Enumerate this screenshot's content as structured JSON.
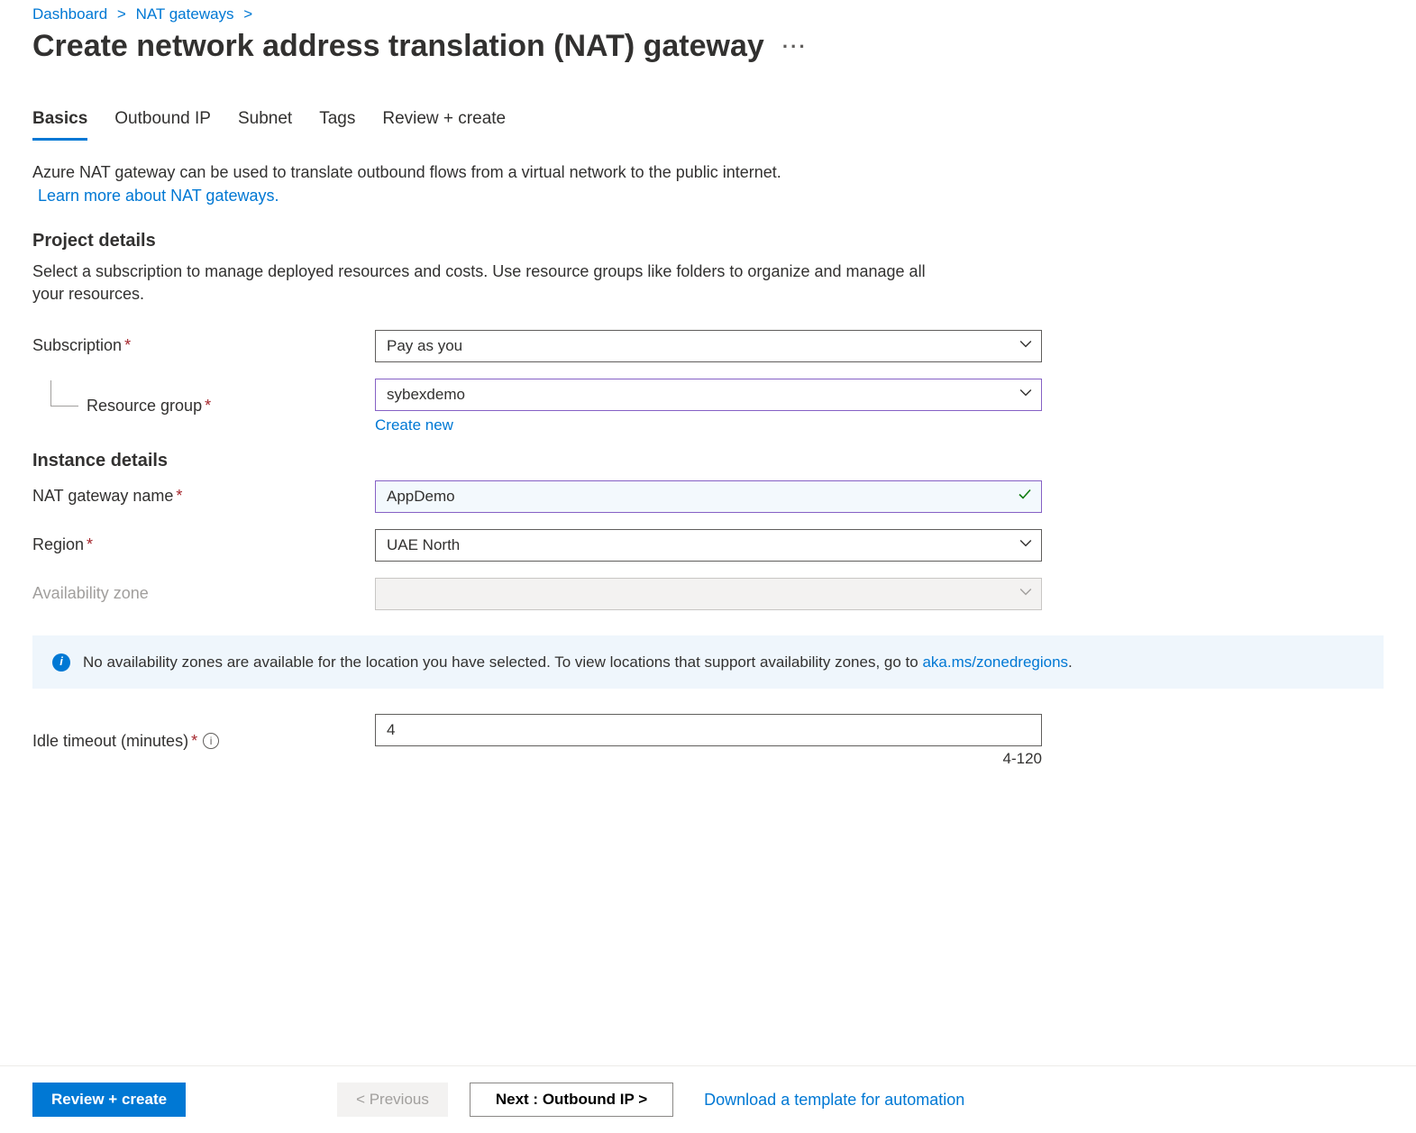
{
  "breadcrumb": {
    "items": [
      "Dashboard",
      "NAT gateways"
    ]
  },
  "page": {
    "title": "Create network address translation (NAT) gateway"
  },
  "tabs": {
    "items": [
      {
        "label": "Basics",
        "active": true
      },
      {
        "label": "Outbound IP",
        "active": false
      },
      {
        "label": "Subnet",
        "active": false
      },
      {
        "label": "Tags",
        "active": false
      },
      {
        "label": "Review + create",
        "active": false
      }
    ]
  },
  "intro": {
    "text": "Azure NAT gateway can be used to translate outbound flows from a virtual network to the public internet.",
    "link": "Learn more about NAT gateways."
  },
  "project": {
    "heading": "Project details",
    "desc": "Select a subscription to manage deployed resources and costs. Use resource groups like folders to organize and manage all your resources.",
    "subscription": {
      "label": "Subscription",
      "value": "Pay as you"
    },
    "resource_group": {
      "label": "Resource group",
      "value": "sybexdemo",
      "create_link": "Create new"
    }
  },
  "instance": {
    "heading": "Instance details",
    "name": {
      "label": "NAT gateway name",
      "value": "AppDemo"
    },
    "region": {
      "label": "Region",
      "value": "UAE North"
    },
    "az": {
      "label": "Availability zone",
      "value": ""
    }
  },
  "info": {
    "text": "No availability zones are available for the location you have selected. To view locations that support availability zones, go to ",
    "link": "aka.ms/zonedregions",
    "suffix": "."
  },
  "idle": {
    "label": "Idle timeout (minutes)",
    "value": "4",
    "range": "4-120"
  },
  "footer": {
    "review": "Review + create",
    "previous": "< Previous",
    "next": "Next : Outbound IP >",
    "download": "Download a template for automation"
  }
}
